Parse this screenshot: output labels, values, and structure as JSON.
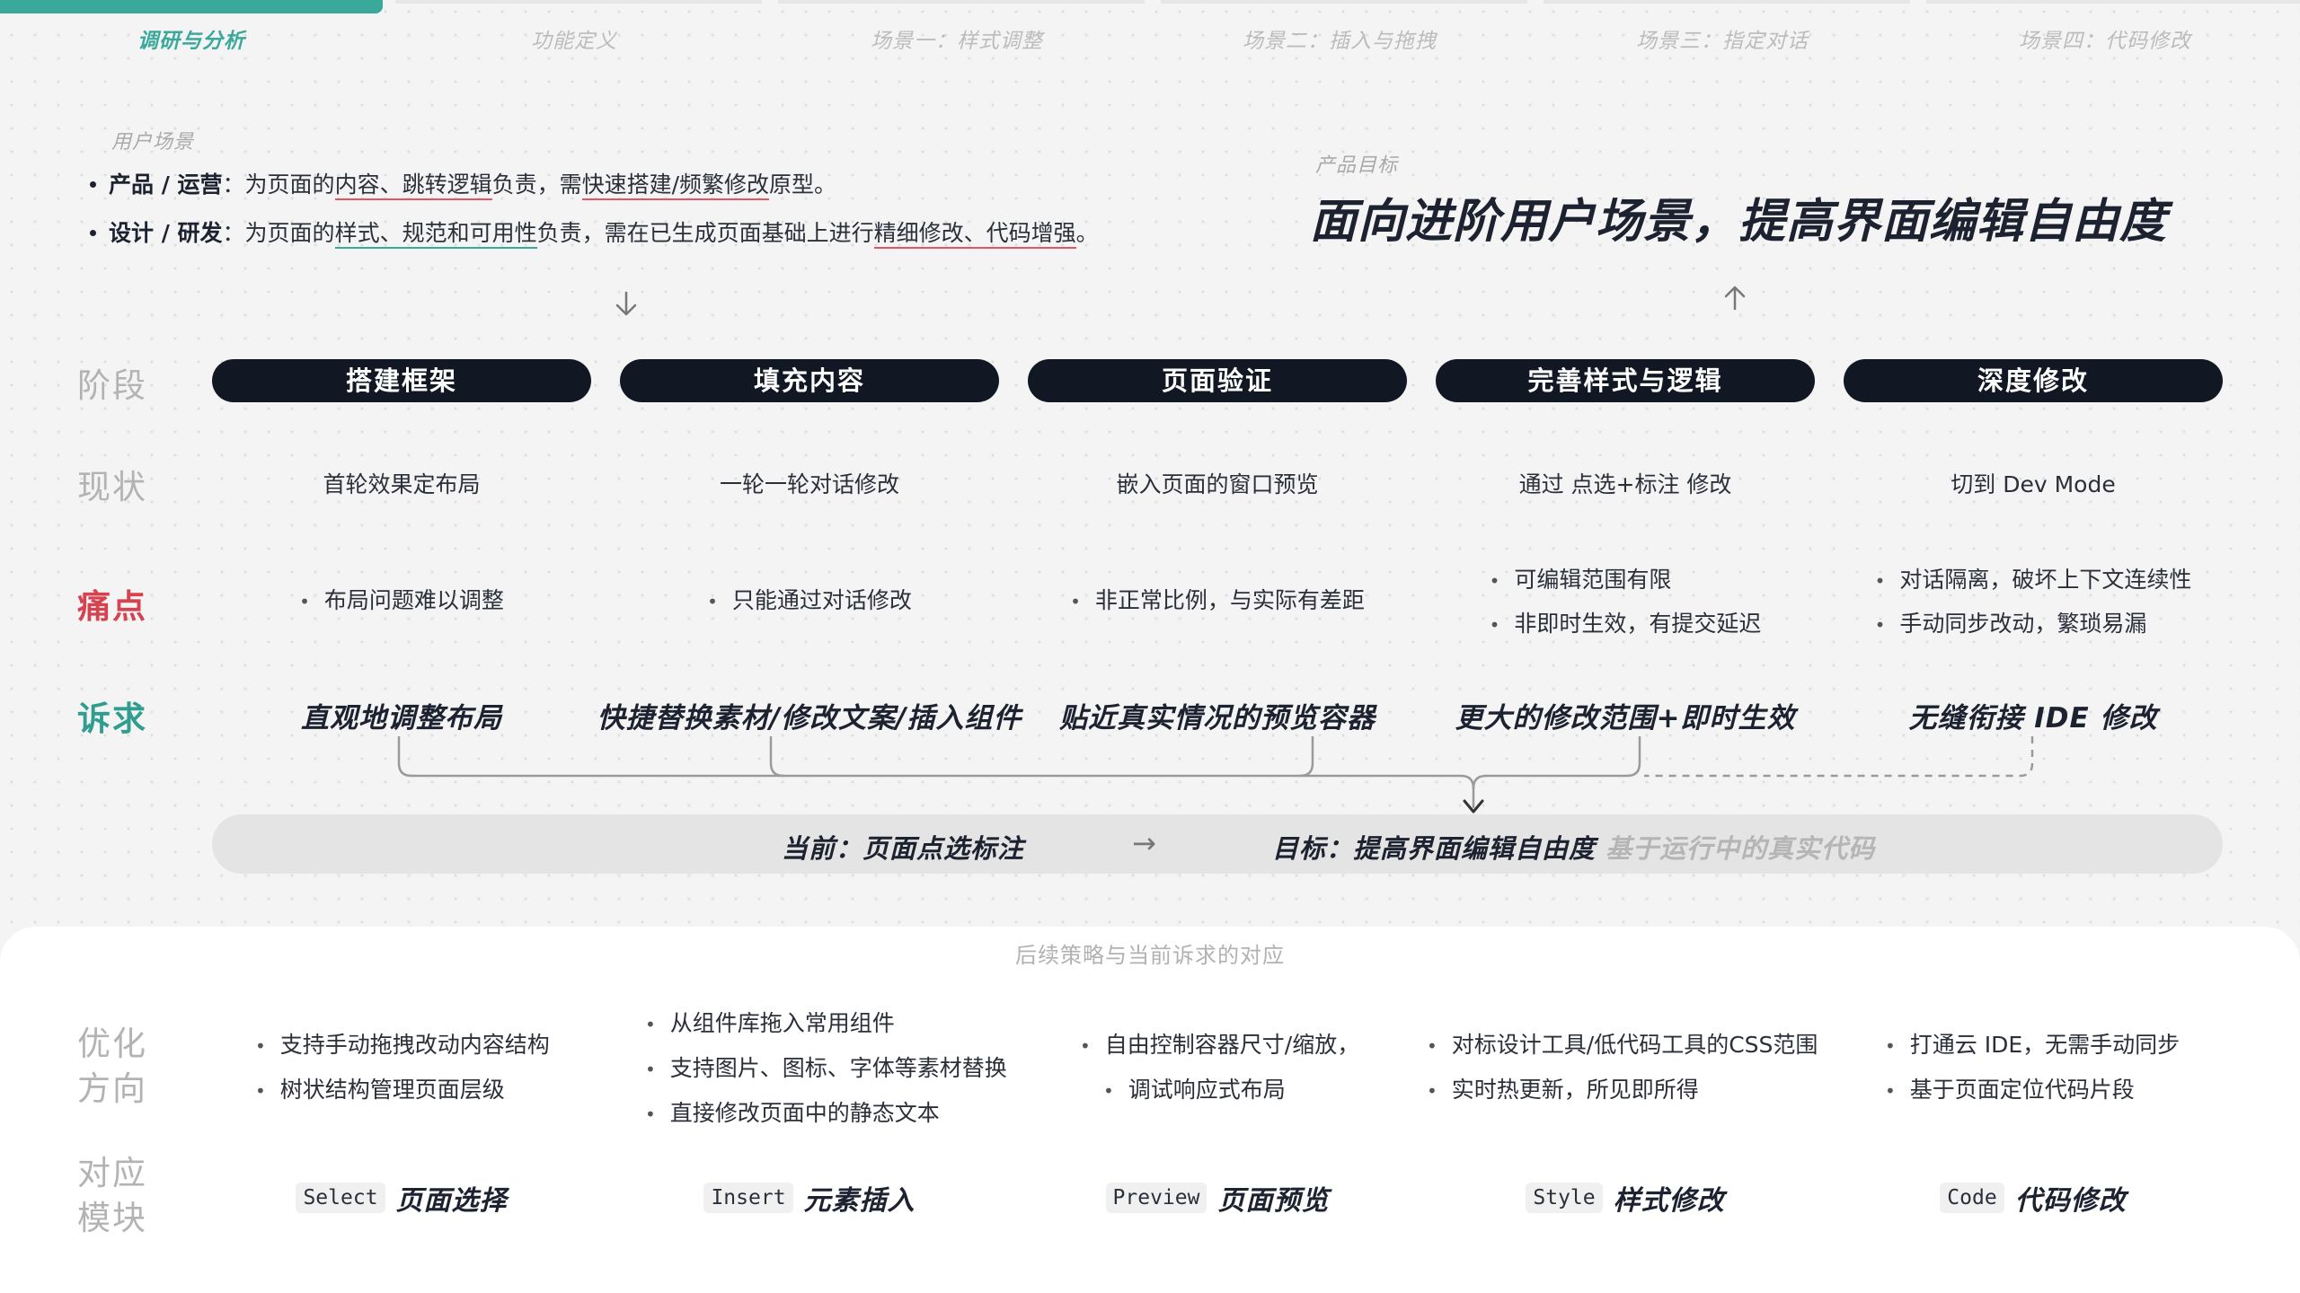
{
  "tabs": [
    {
      "label": "调研与分析",
      "active": true
    },
    {
      "label": "功能定义",
      "active": false
    },
    {
      "label": "场景一：样式调整",
      "active": false
    },
    {
      "label": "场景二：插入与拖拽",
      "active": false
    },
    {
      "label": "场景三：指定对话",
      "active": false
    },
    {
      "label": "场景四：代码修改",
      "active": false
    }
  ],
  "scenario": {
    "caption": "用户场景",
    "line1": {
      "role": "产品 / 运营",
      "a": "：为页面的",
      "b": "内容、跳转逻辑",
      "c": "负责，需",
      "d": "快速搭建/频繁修改",
      "e": "原型。"
    },
    "line2": {
      "role": "设计 / 研发",
      "a": "：为页面的",
      "b": "样式、规范和可用性",
      "c": "负责，需在已生成页面基础上进行",
      "d": "精细修改、代码增强",
      "e": "。"
    }
  },
  "goal": {
    "caption": "产品目标",
    "title": "面向进阶用户场景，提高界面编辑自由度"
  },
  "row_labels": {
    "stage": "阶段",
    "status": "现状",
    "pain": "痛点",
    "need": "诉求"
  },
  "stages": [
    {
      "name": "搭建框架",
      "status": "首轮效果定布局",
      "pains": [
        "布局问题难以调整"
      ],
      "need": "直观地调整布局"
    },
    {
      "name": "填充内容",
      "status": "一轮一轮对话修改",
      "pains": [
        "只能通过对话修改"
      ],
      "need": "快捷替换素材/修改文案/插入组件"
    },
    {
      "name": "页面验证",
      "status": "嵌入页面的窗口预览",
      "pains": [
        "非正常比例，与实际有差距"
      ],
      "need": "贴近真实情况的预览容器"
    },
    {
      "name": "完善样式与逻辑",
      "status": "通过 点选+标注 修改",
      "pains": [
        "可编辑范围有限",
        "非即时生效，有提交延迟"
      ],
      "need": "更大的修改范围+即时生效"
    },
    {
      "name": "深度修改",
      "status": "切到 Dev Mode",
      "pains": [
        "对话隔离，破坏上下文连续性",
        "手动同步改动，繁琐易漏"
      ],
      "need": "无缝衔接 IDE 修改"
    }
  ],
  "target_bar": {
    "current": "当前：页面点选标注",
    "arrow": "→",
    "target": "目标：提高界面编辑自由度",
    "note": "基于运行中的真实代码"
  },
  "panel": {
    "caption": "后续策略与当前诉求的对应",
    "label_opt_1": "优化",
    "label_opt_2": "方向",
    "label_mod_1": "对应",
    "label_mod_2": "模块",
    "optimizations": [
      [
        "支持手动拖拽改动内容结构",
        "树状结构管理页面层级"
      ],
      [
        "从组件库拖入常用组件",
        "支持图片、图标、字体等素材替换",
        "直接修改页面中的静态文本"
      ],
      [
        "自由控制容器尺寸/缩放，",
        "调试响应式布局"
      ],
      [
        "对标设计工具/低代码工具的CSS范围",
        "实时热更新，所见即所得"
      ],
      [
        "打通云 IDE，无需手动同步",
        "基于页面定位代码片段"
      ]
    ],
    "modules": [
      {
        "code": "Select",
        "name": "页面选择"
      },
      {
        "code": "Insert",
        "name": "元素插入"
      },
      {
        "code": "Preview",
        "name": "页面预览"
      },
      {
        "code": "Style",
        "name": "样式修改"
      },
      {
        "code": "Code",
        "name": "代码修改"
      }
    ]
  },
  "colors": {
    "accent_teal": "#3aa99b",
    "pain_red": "#d4434f",
    "pill_dark": "#121823"
  }
}
